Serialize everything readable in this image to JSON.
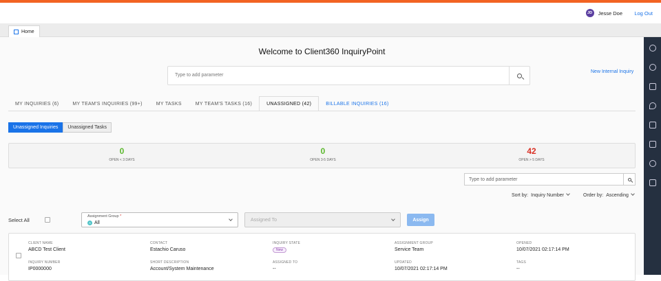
{
  "colors": {
    "accent": "#f26322",
    "primary": "#1a73e8",
    "rail": "#253040",
    "green": "#5cb82e",
    "red": "#d93025"
  },
  "user": {
    "initials": "JD",
    "name": "Jesse Doe",
    "logout": "Log Out"
  },
  "tabstrip": {
    "home_label": "Home"
  },
  "page": {
    "title": "Welcome to Client360 InquiryPoint",
    "search_placeholder": "Type to add parameter",
    "new_inquiry": "New Internal Inquiry"
  },
  "tabs": [
    {
      "label": "MY INQUIRIES (6)"
    },
    {
      "label": "MY TEAM'S INQUIRIES (99+)"
    },
    {
      "label": "MY TASKS"
    },
    {
      "label": "MY TEAM'S TASKS (16)"
    },
    {
      "label": "UNASSIGNED (42)"
    },
    {
      "label": "BILLABLE INQUIRIES (16)"
    }
  ],
  "segments": {
    "inquiries": "Unassigned Inquiries",
    "tasks": "Unassigned Tasks"
  },
  "stats": [
    {
      "value": "0",
      "label": "OPEN < 3 DAYS"
    },
    {
      "value": "0",
      "label": "OPEN 3-5 DAYS"
    },
    {
      "value": "42",
      "label": "OPEN > 5 DAYS"
    }
  ],
  "filter": {
    "search_placeholder": "Type to add parameter"
  },
  "sort": {
    "sort_label": "Sort by:",
    "sort_value": "Inquiry Number",
    "order_label": "Order by:",
    "order_value": "Ascending"
  },
  "assign_bar": {
    "select_all": "Select All",
    "group_label": "Assignment Group",
    "group_required": "*",
    "group_avatar": "A",
    "group_value": "All",
    "assigned_to_placeholder": "Assigned To",
    "assign_button": "Assign"
  },
  "card": {
    "client_name_label": "CLIENT NAME",
    "client_name": "ABCD Test Client",
    "contact_label": "CONTACT",
    "contact": "Estachio Caruso",
    "state_label": "INQUIRY STATE",
    "state": "New",
    "group_label": "ASSIGNMENT GROUP",
    "group": "Service Team",
    "opened_label": "OPENED",
    "opened": "10/07/2021 02:17:14 PM",
    "number_label": "INQUIRY NUMBER",
    "number": "IP0000000",
    "desc_label": "SHORT DESCRIPTION",
    "desc": "Account/System Maintenance",
    "assigned_label": "ASSIGNED TO",
    "assigned": "--",
    "updated_label": "UPDATED",
    "updated": "10/07/2021 02:17:14 PM",
    "tags_label": "TAGS",
    "tags": "--"
  },
  "rail_icons": [
    "link-icon",
    "dashboard-icon",
    "calendar-icon",
    "pin-icon",
    "box-icon",
    "image-icon",
    "lightbulb-icon",
    "scan-icon"
  ]
}
